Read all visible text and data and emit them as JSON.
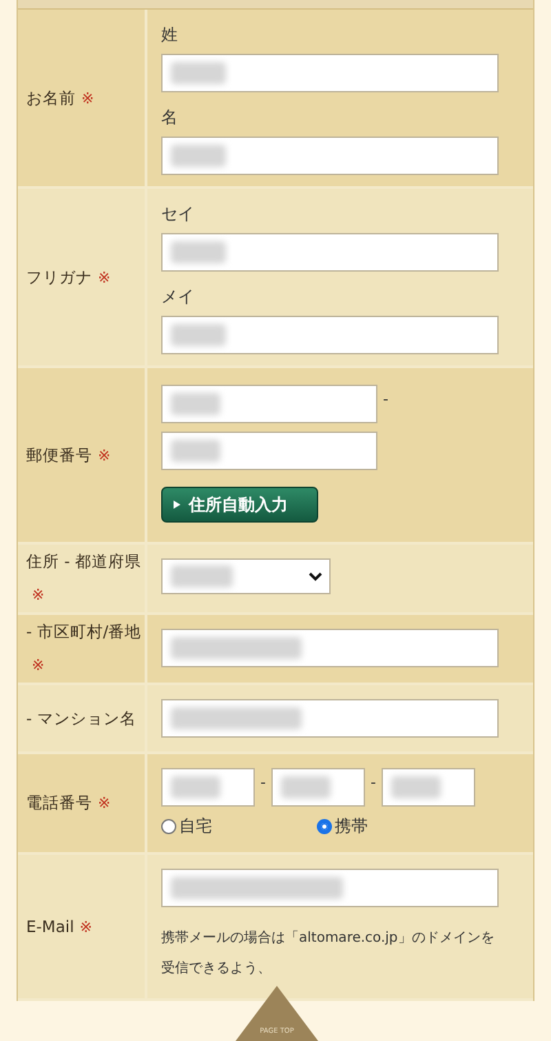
{
  "form_rows": [
    {
      "kind": "captioned",
      "label": "お名前",
      "required_mark": "※",
      "fields": [
        {
          "caption": "姓",
          "redacted": true
        },
        {
          "caption": "名",
          "redacted": true
        }
      ]
    },
    {
      "kind": "captioned",
      "label": "フリガナ",
      "required_mark": "※",
      "fields": [
        {
          "caption": "セイ",
          "redacted": true
        },
        {
          "caption": "メイ",
          "redacted": true
        }
      ]
    },
    {
      "kind": "postal",
      "label": "郵便番号",
      "required_mark": "※",
      "separator": "-",
      "fields": [
        {
          "redacted": true
        },
        {
          "redacted": true
        }
      ],
      "button": {
        "label": "住所自動入力"
      }
    },
    {
      "kind": "select",
      "label": "住所 - 都道府県",
      "required_mark": "※",
      "fields": [
        {
          "redacted": true
        }
      ]
    },
    {
      "kind": "text",
      "label": "- 市区町村/番地",
      "required_mark": "※",
      "fields": [
        {
          "redacted": true
        }
      ]
    },
    {
      "kind": "text",
      "label": "- マンション名",
      "fields": [
        {
          "redacted": true
        }
      ]
    },
    {
      "kind": "phone",
      "label": "電話番号",
      "required_mark": "※",
      "separators": [
        "-",
        "-"
      ],
      "fields": [
        {
          "redacted": true
        },
        {
          "redacted": true
        },
        {
          "redacted": true
        }
      ],
      "radios": [
        {
          "label": "自宅",
          "selected": false
        },
        {
          "label": "携帯",
          "selected": true
        }
      ]
    },
    {
      "kind": "email",
      "label": "E-Mail",
      "required_mark": "※",
      "fields": [
        {
          "redacted": true
        }
      ],
      "note": "携帯メールの場合は「altomare.co.jp」のドメインを受信できるよう、"
    }
  ],
  "page_top": {
    "label": "PAGE TOP"
  }
}
